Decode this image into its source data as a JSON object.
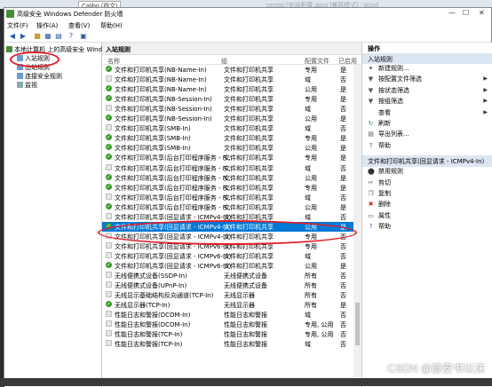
{
  "bg": {
    "calibri": "Calibri (西文)",
    "doc": "centos7安装配置.docx [兼容模式] - Word"
  },
  "window": {
    "title": "高级安全 Windows Defender 防火墙"
  },
  "menu": {
    "file": "文件(F)",
    "action": "操作(A)",
    "view": "查看(V)",
    "help": "帮助(H)"
  },
  "tree": {
    "root": "本地计算机 上的高级安全 Windo",
    "inbound": "入站规则",
    "outbound": "出站规则",
    "connection": "连接安全规则",
    "monitor": "监视"
  },
  "center": {
    "header": "入站规则",
    "columns": {
      "name": "名称",
      "group": "组",
      "profile": "配置文件",
      "enabled": "已启用"
    },
    "rows": [
      {
        "name": "文件和打印机共享(NB-Name-In)",
        "group": "文件和打印机共享",
        "profile": "专用",
        "enabled": "是",
        "on": true
      },
      {
        "name": "文件和打印机共享(NB-Name-In)",
        "group": "文件和打印机共享",
        "profile": "域",
        "enabled": "否",
        "on": false
      },
      {
        "name": "文件和打印机共享(NB-Name-In)",
        "group": "文件和打印机共享",
        "profile": "公用",
        "enabled": "是",
        "on": true
      },
      {
        "name": "文件和打印机共享(NB-Session-In)",
        "group": "文件和打印机共享",
        "profile": "专用",
        "enabled": "是",
        "on": true
      },
      {
        "name": "文件和打印机共享(NB-Session-In)",
        "group": "文件和打印机共享",
        "profile": "域",
        "enabled": "否",
        "on": false
      },
      {
        "name": "文件和打印机共享(NB-Session-In)",
        "group": "文件和打印机共享",
        "profile": "公用",
        "enabled": "是",
        "on": true
      },
      {
        "name": "文件和打印机共享(SMB-In)",
        "group": "文件和打印机共享",
        "profile": "域",
        "enabled": "否",
        "on": false
      },
      {
        "name": "文件和打印机共享(SMB-In)",
        "group": "文件和打印机共享",
        "profile": "专用",
        "enabled": "是",
        "on": true
      },
      {
        "name": "文件和打印机共享(SMB-In)",
        "group": "文件和打印机共享",
        "profile": "公用",
        "enabled": "是",
        "on": true
      },
      {
        "name": "文件和打印机共享(后台打印程序服务 - R...",
        "group": "文件和打印机共享",
        "profile": "专用",
        "enabled": "是",
        "on": true
      },
      {
        "name": "文件和打印机共享(后台打印程序服务 - R...",
        "group": "文件和打印机共享",
        "profile": "域",
        "enabled": "否",
        "on": false
      },
      {
        "name": "文件和打印机共享(后台打印程序服务 - R...",
        "group": "文件和打印机共享",
        "profile": "公用",
        "enabled": "是",
        "on": true
      },
      {
        "name": "文件和打印机共享(后台打印程序服务 - R...",
        "group": "文件和打印机共享",
        "profile": "专用",
        "enabled": "是",
        "on": true
      },
      {
        "name": "文件和打印机共享(后台打印程序服务 - R...",
        "group": "文件和打印机共享",
        "profile": "域",
        "enabled": "否",
        "on": false
      },
      {
        "name": "文件和打印机共享(后台打印程序服务 - R...",
        "group": "文件和打印机共享",
        "profile": "公用",
        "enabled": "是",
        "on": true
      },
      {
        "name": "文件和打印机共享(回显请求 - ICMPv4-In)",
        "group": "文件和打印机共享",
        "profile": "域",
        "enabled": "否",
        "on": false
      },
      {
        "name": "文件和打印机共享(回显请求 - ICMPv4-In)",
        "group": "文件和打印机共享",
        "profile": "公用",
        "enabled": "是",
        "on": true,
        "selected": true
      },
      {
        "name": "文件和打印机共享(回显请求 - ICMPv4-In)",
        "group": "文件和打印机共享",
        "profile": "专用",
        "enabled": "否",
        "on": false
      },
      {
        "name": "文件和打印机共享(回显请求 - ICMPv6-In)",
        "group": "文件和打印机共享",
        "profile": "专用",
        "enabled": "否",
        "on": false
      },
      {
        "name": "文件和打印机共享(回显请求 - ICMPv6-In)",
        "group": "文件和打印机共享",
        "profile": "域",
        "enabled": "否",
        "on": false
      },
      {
        "name": "文件和打印机共享(回显请求 - ICMPv6-In)",
        "group": "文件和打印机共享",
        "profile": "公用",
        "enabled": "是",
        "on": true
      },
      {
        "name": "无线便携式设备(SSDP-In)",
        "group": "无线便携式设备",
        "profile": "所有",
        "enabled": "否",
        "on": false
      },
      {
        "name": "无线便携式设备(UPnP-In)",
        "group": "无线便携式设备",
        "profile": "所有",
        "enabled": "否",
        "on": false
      },
      {
        "name": "无线显示基础结构反向通道(TCP-In)",
        "group": "无线显示器",
        "profile": "所有",
        "enabled": "否",
        "on": false
      },
      {
        "name": "无线显示器(TCP-In)",
        "group": "无线显示器",
        "profile": "所有",
        "enabled": "是",
        "on": true
      },
      {
        "name": "性能日志和警报(DCOM-In)",
        "group": "性能日志和警报",
        "profile": "域",
        "enabled": "否",
        "on": false
      },
      {
        "name": "性能日志和警报(DCOM-In)",
        "group": "性能日志和警报",
        "profile": "专用, 公用",
        "enabled": "否",
        "on": false
      },
      {
        "name": "性能日志和警报(TCP-In)",
        "group": "性能日志和警报",
        "profile": "专用, 公用",
        "enabled": "否",
        "on": false
      },
      {
        "name": "性能日志和警报(TCP-In)",
        "group": "性能日志和警报",
        "profile": "域",
        "enabled": "否",
        "on": false
      }
    ]
  },
  "actions": {
    "title": "操作",
    "section1": "入站规则",
    "s1": [
      "新建规则...",
      "按配置文件筛选",
      "按状态筛选",
      "按组筛选",
      "查看",
      "刷新",
      "导出列表...",
      "帮助"
    ],
    "section2": "文件和打印机共享(回显请求 - ICMPv4-In)",
    "s2": [
      "禁用规则",
      "剪切",
      "复制",
      "删除",
      "属性",
      "帮助"
    ]
  },
  "watermark": "CSDN @静安书以沫"
}
